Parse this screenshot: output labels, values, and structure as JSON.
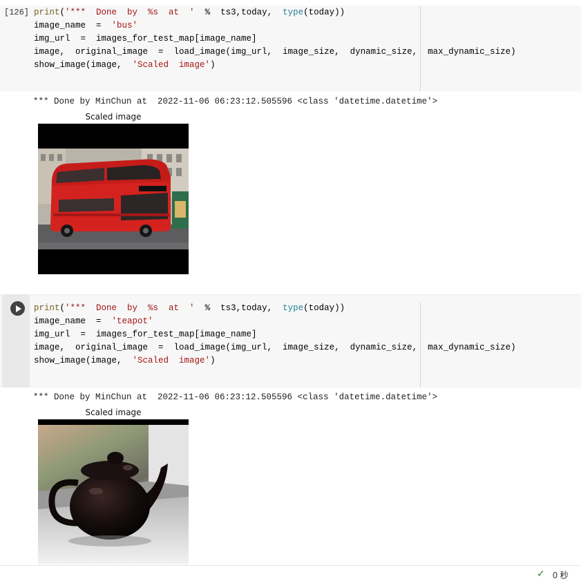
{
  "cell1": {
    "exec_count": "[126]",
    "code": {
      "l1": {
        "fn": "print",
        "open": "(",
        "str": "'***  Done  by  %s  at  '",
        "rest1": "  %  ts3,today,  ",
        "type_kw": "type",
        "rest2": "(today))"
      },
      "l2": {
        "lhs": "image_name  =  ",
        "str": "'bus'"
      },
      "l3": "img_url  =  images_for_test_map[image_name]",
      "l4": "image,  original_image  =  load_image(img_url,  image_size,  dynamic_size,  max_dynamic_size)",
      "l5": {
        "fn": "show_image(image,  ",
        "str": "'Scaled  image'",
        "close": ")"
      }
    },
    "output_text": "*** Done by MinChun at  2022-11-06 06:23:12.505596 <class 'datetime.datetime'>",
    "figure_title": "Scaled image"
  },
  "cell2": {
    "run_icon": "play-circle-icon",
    "code": {
      "l1": {
        "fn": "print",
        "open": "(",
        "str": "'***  Done  by  %s  at  '",
        "rest1": "  %  ts3,today,  ",
        "type_kw": "type",
        "rest2": "(today))"
      },
      "l2": {
        "lhs": "image_name  =  ",
        "str": "'teapot'"
      },
      "l3": "img_url  =  images_for_test_map[image_name]",
      "l4": "image,  original_image  =  load_image(img_url,  image_size,  dynamic_size,  max_dynamic_size)",
      "l5": {
        "fn": "show_image(image,  ",
        "str": "'Scaled  image'",
        "close": ")"
      }
    },
    "output_text": "*** Done by MinChun at  2022-11-06 06:23:12.505596 <class 'datetime.datetime'>",
    "figure_title": "Scaled image"
  },
  "status": {
    "icon": "check-icon",
    "check": "✓",
    "text": "0 秒",
    "color": "#2e7d32"
  }
}
